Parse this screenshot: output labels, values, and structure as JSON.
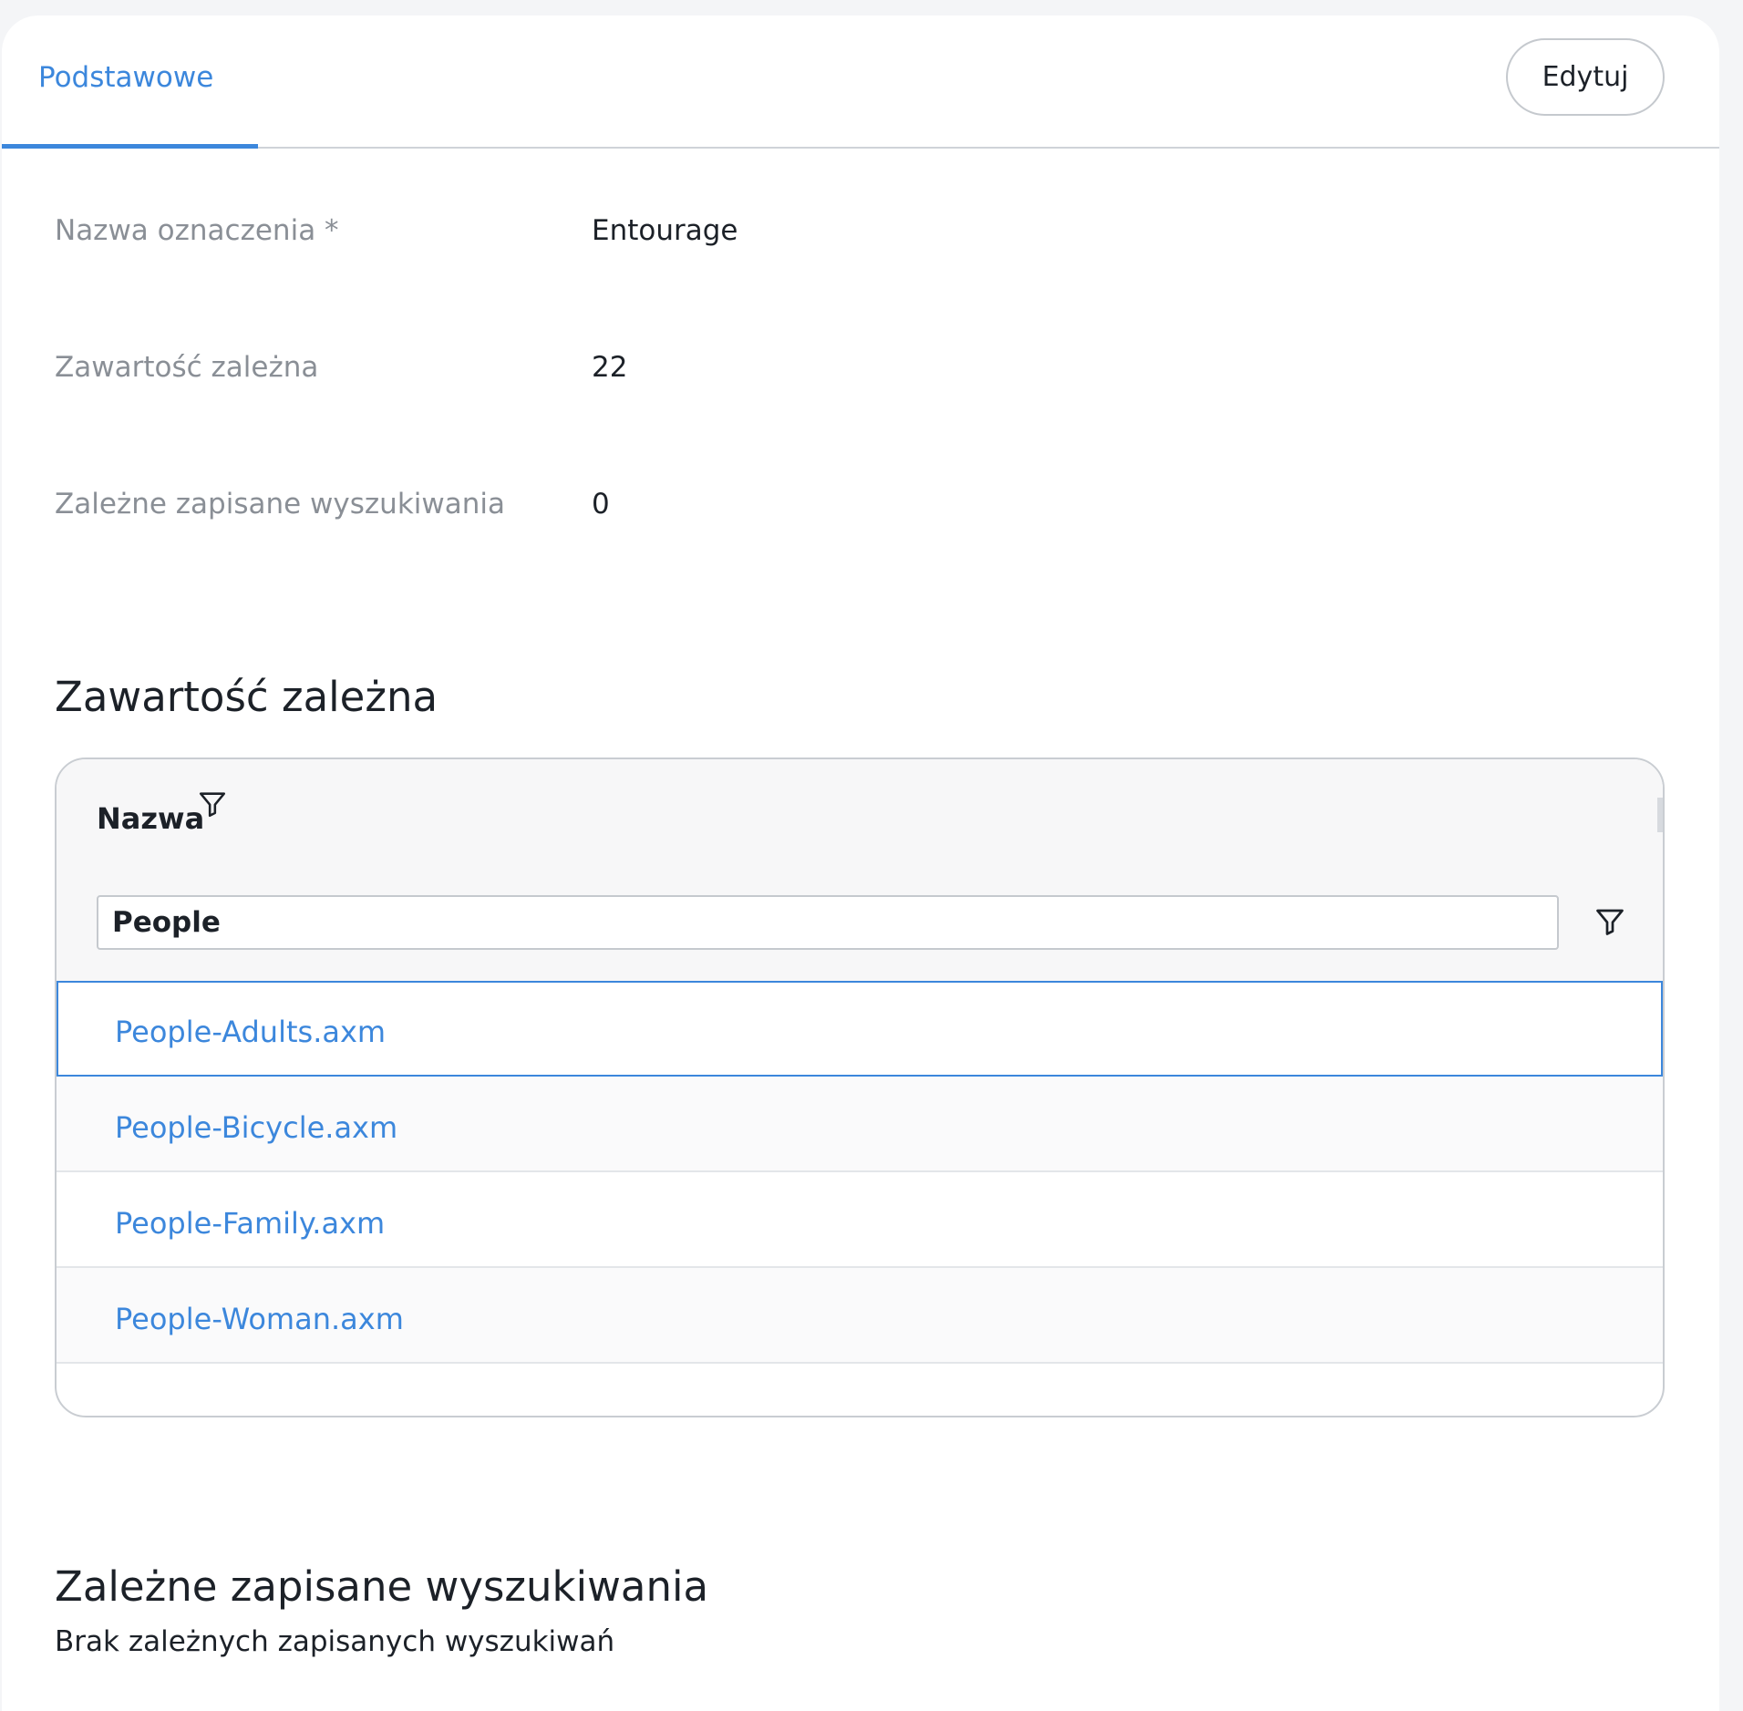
{
  "tabs": [
    {
      "label": "Podstawowe",
      "active": true
    }
  ],
  "toolbar": {
    "edit_label": "Edytuj"
  },
  "properties": [
    {
      "label": "Nazwa oznaczenia *",
      "value": "Entourage"
    },
    {
      "label": "Zawartość zależna",
      "value": "22"
    },
    {
      "label": "Zależne zapisane wyszukiwania",
      "value": "0"
    }
  ],
  "dependent_content": {
    "heading": "Zawartość zależna",
    "column_title": "Nazwa",
    "filter_value": "People",
    "rows": [
      {
        "name": "People-Adults.axm",
        "selected": true
      },
      {
        "name": "People-Bicycle.axm",
        "selected": false
      },
      {
        "name": "People-Family.axm",
        "selected": false
      },
      {
        "name": "People-Woman.axm",
        "selected": false
      }
    ]
  },
  "saved_searches": {
    "heading": "Zależne zapisane wyszukiwania",
    "empty_text": "Brak zależnych zapisanych wyszukiwań"
  },
  "icons": {
    "filter": "filter-funnel-icon"
  },
  "colors": {
    "accent": "#3c87dc",
    "text": "#1c2128",
    "muted": "#8a8f96"
  }
}
